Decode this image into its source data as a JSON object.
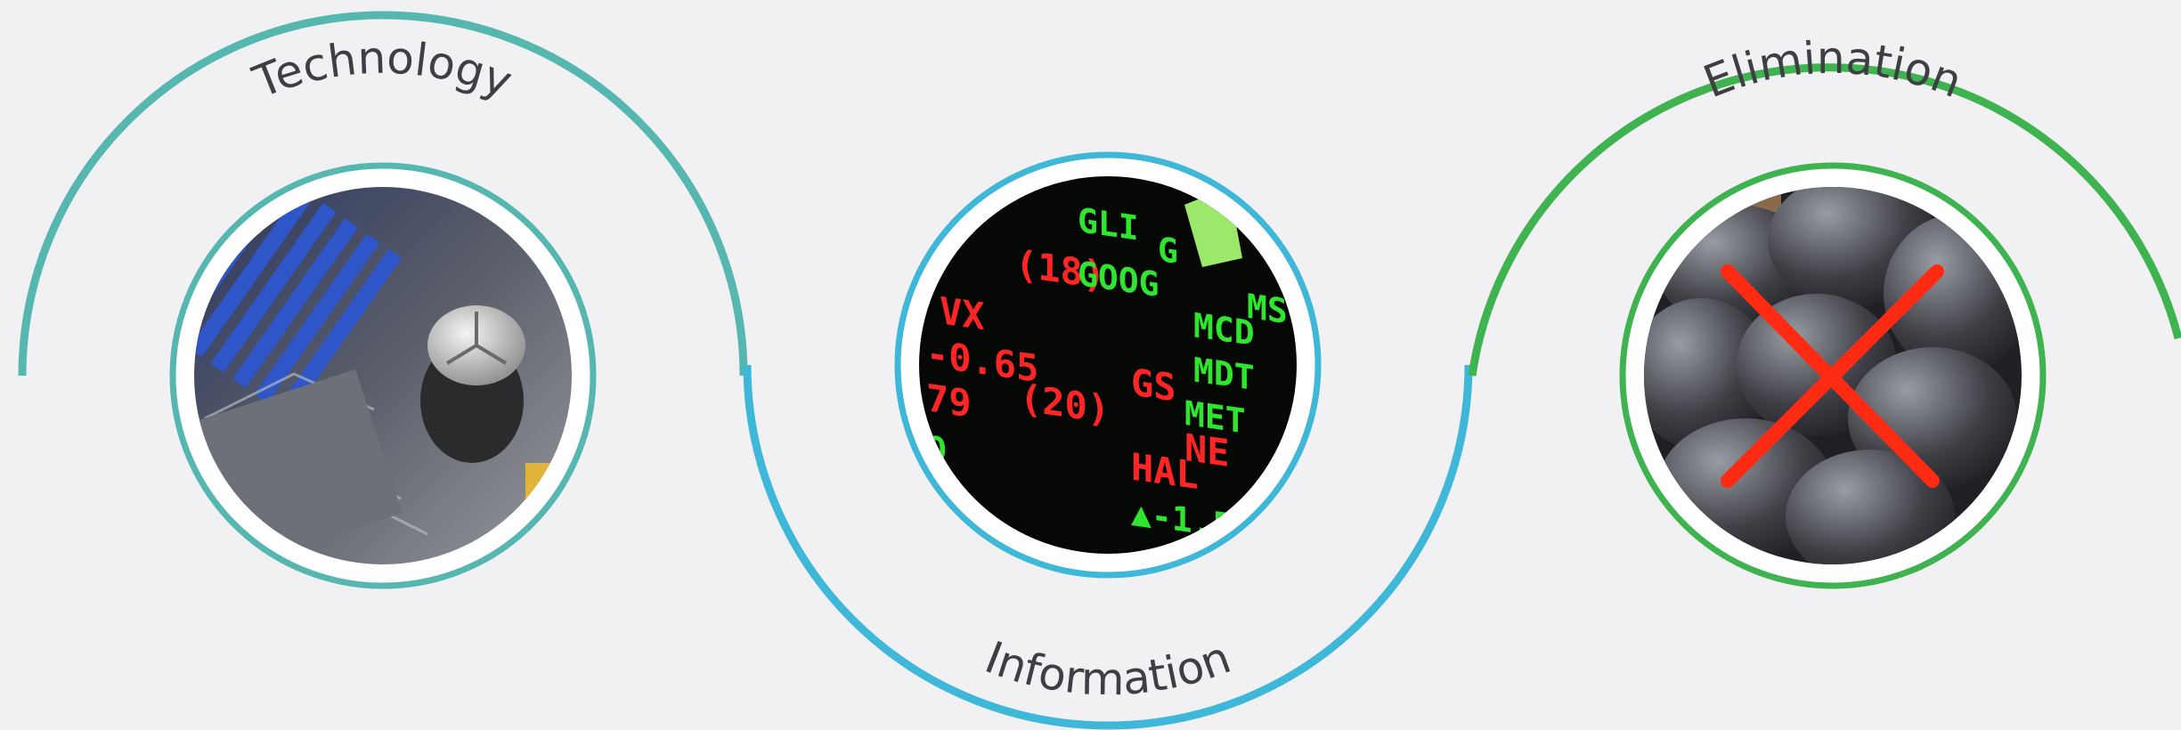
{
  "stages": [
    {
      "id": "technology",
      "label": "Technology",
      "arc": "top",
      "color": "#55b7b0",
      "image": "circuit-board-photo"
    },
    {
      "id": "information",
      "label": "Information",
      "arc": "bottom",
      "color": "#3fb7d9",
      "image": "stock-ticker-board-photo"
    },
    {
      "id": "elimination",
      "label": "Elimination",
      "arc": "top",
      "color": "#3fb34f",
      "image": "garbage-bags-crossed-out-photo"
    }
  ],
  "background": "#f1f1f3"
}
